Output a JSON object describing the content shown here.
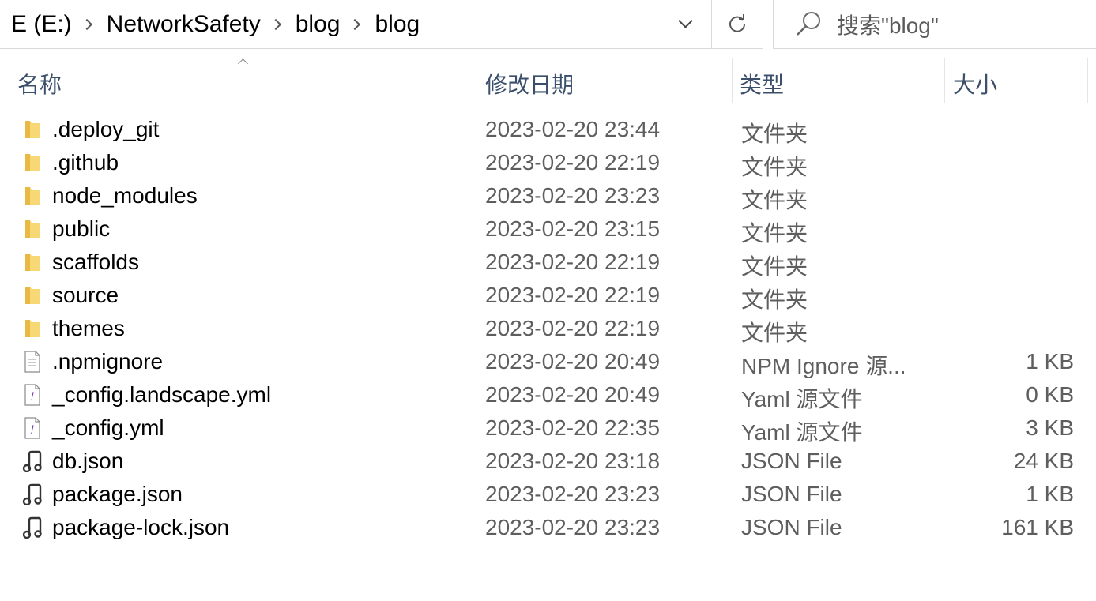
{
  "address": {
    "crumbs": [
      "E (E:)",
      "NetworkSafety",
      "blog",
      "blog"
    ]
  },
  "search": {
    "placeholder": "搜索\"blog\""
  },
  "columns": {
    "name": "名称",
    "date": "修改日期",
    "type": "类型",
    "size": "大小"
  },
  "files": [
    {
      "icon": "folder-icon",
      "name": ".deploy_git",
      "date": "2023-02-20 23:44",
      "type": "文件夹",
      "size": ""
    },
    {
      "icon": "folder-icon",
      "name": ".github",
      "date": "2023-02-20 22:19",
      "type": "文件夹",
      "size": ""
    },
    {
      "icon": "folder-icon",
      "name": "node_modules",
      "date": "2023-02-20 23:23",
      "type": "文件夹",
      "size": ""
    },
    {
      "icon": "folder-icon",
      "name": "public",
      "date": "2023-02-20 23:15",
      "type": "文件夹",
      "size": ""
    },
    {
      "icon": "folder-icon",
      "name": "scaffolds",
      "date": "2023-02-20 22:19",
      "type": "文件夹",
      "size": ""
    },
    {
      "icon": "folder-icon",
      "name": "source",
      "date": "2023-02-20 22:19",
      "type": "文件夹",
      "size": ""
    },
    {
      "icon": "folder-icon",
      "name": "themes",
      "date": "2023-02-20 22:19",
      "type": "文件夹",
      "size": ""
    },
    {
      "icon": "text-file-icon",
      "name": ".npmignore",
      "date": "2023-02-20 20:49",
      "type": "NPM Ignore 源...",
      "size": "1 KB"
    },
    {
      "icon": "yaml-file-icon",
      "name": "_config.landscape.yml",
      "date": "2023-02-20 20:49",
      "type": "Yaml 源文件",
      "size": "0 KB"
    },
    {
      "icon": "yaml-file-icon",
      "name": "_config.yml",
      "date": "2023-02-20 22:35",
      "type": "Yaml 源文件",
      "size": "3 KB"
    },
    {
      "icon": "json-file-icon",
      "name": "db.json",
      "date": "2023-02-20 23:18",
      "type": "JSON File",
      "size": "24 KB"
    },
    {
      "icon": "json-file-icon",
      "name": "package.json",
      "date": "2023-02-20 23:23",
      "type": "JSON File",
      "size": "1 KB"
    },
    {
      "icon": "json-file-icon",
      "name": "package-lock.json",
      "date": "2023-02-20 23:23",
      "type": "JSON File",
      "size": "161 KB"
    }
  ]
}
